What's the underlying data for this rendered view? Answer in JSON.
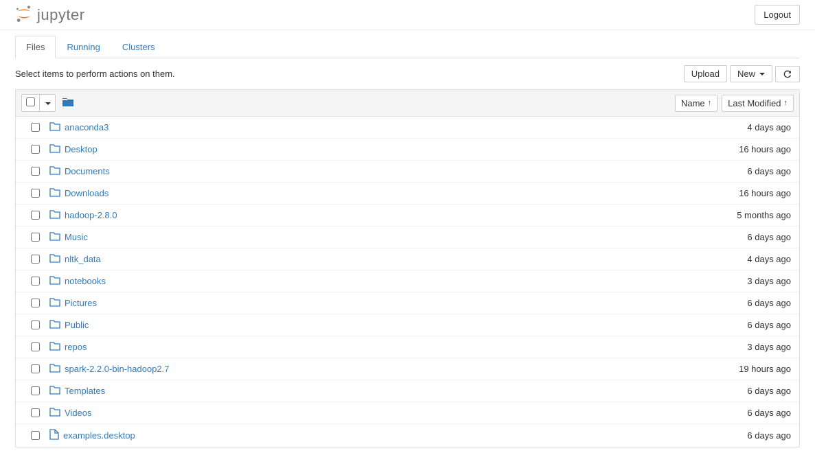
{
  "header": {
    "logo_text": "jupyter",
    "logout_label": "Logout"
  },
  "tabs": {
    "files": "Files",
    "running": "Running",
    "clusters": "Clusters"
  },
  "toolbar": {
    "hint_text": "Select items to perform actions on them.",
    "upload_label": "Upload",
    "new_label": "New"
  },
  "list_header": {
    "name_label": "Name",
    "modified_label": "Last Modified"
  },
  "items": [
    {
      "type": "folder",
      "name": "anaconda3",
      "modified": "4 days ago"
    },
    {
      "type": "folder",
      "name": "Desktop",
      "modified": "16 hours ago"
    },
    {
      "type": "folder",
      "name": "Documents",
      "modified": "6 days ago"
    },
    {
      "type": "folder",
      "name": "Downloads",
      "modified": "16 hours ago"
    },
    {
      "type": "folder",
      "name": "hadoop-2.8.0",
      "modified": "5 months ago"
    },
    {
      "type": "folder",
      "name": "Music",
      "modified": "6 days ago"
    },
    {
      "type": "folder",
      "name": "nltk_data",
      "modified": "4 days ago"
    },
    {
      "type": "folder",
      "name": "notebooks",
      "modified": "3 days ago"
    },
    {
      "type": "folder",
      "name": "Pictures",
      "modified": "6 days ago"
    },
    {
      "type": "folder",
      "name": "Public",
      "modified": "6 days ago"
    },
    {
      "type": "folder",
      "name": "repos",
      "modified": "3 days ago"
    },
    {
      "type": "folder",
      "name": "spark-2.2.0-bin-hadoop2.7",
      "modified": "19 hours ago"
    },
    {
      "type": "folder",
      "name": "Templates",
      "modified": "6 days ago"
    },
    {
      "type": "folder",
      "name": "Videos",
      "modified": "6 days ago"
    },
    {
      "type": "file",
      "name": "examples.desktop",
      "modified": "6 days ago"
    }
  ]
}
